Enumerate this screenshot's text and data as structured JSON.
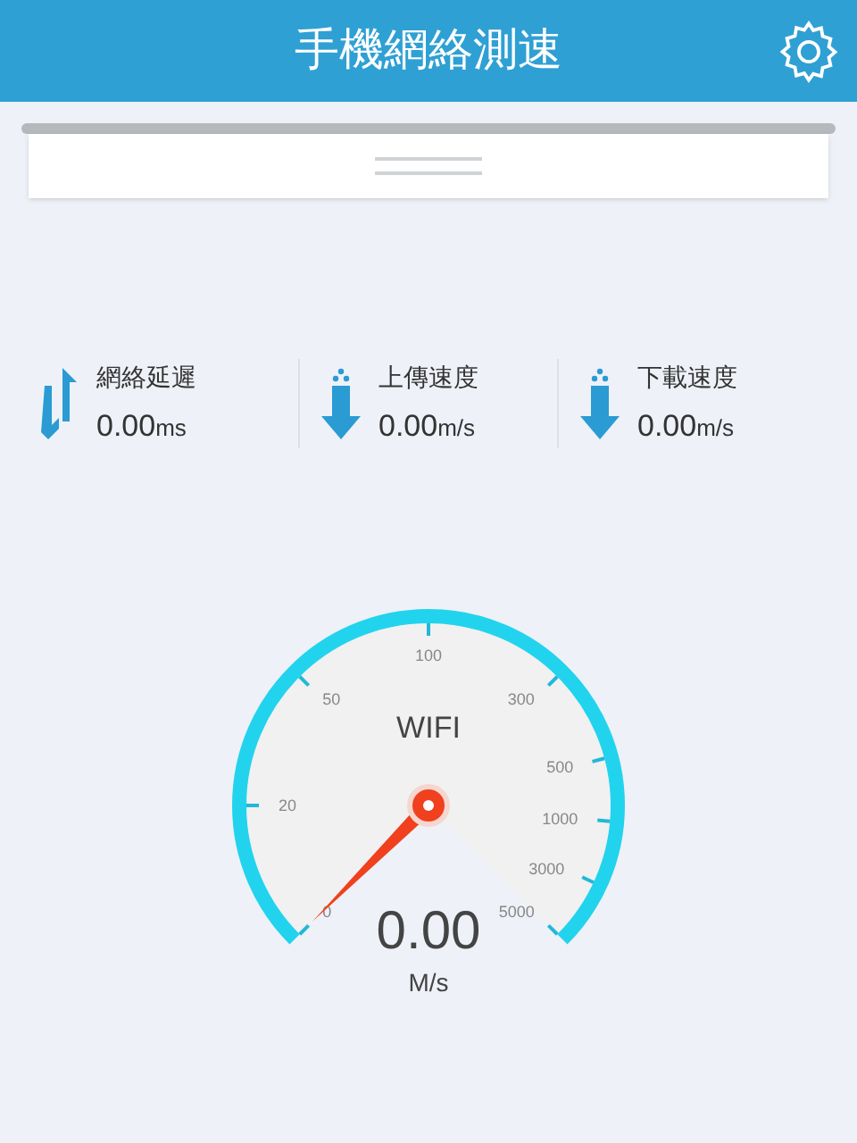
{
  "header": {
    "title": "手機網絡測速"
  },
  "stats": [
    {
      "kind": "latency",
      "label": "網絡延遲",
      "value": "0.00",
      "unit": "ms"
    },
    {
      "kind": "upload",
      "label": "上傳速度",
      "value": "0.00",
      "unit": "m/s"
    },
    {
      "kind": "download",
      "label": "下載速度",
      "value": "0.00",
      "unit": "m/s"
    }
  ],
  "gauge": {
    "network": "WIFI",
    "value": "0.00",
    "unit": "M/s",
    "ticks": [
      "0",
      "20",
      "50",
      "100",
      "300",
      "500",
      "1000",
      "3000",
      "5000"
    ]
  }
}
